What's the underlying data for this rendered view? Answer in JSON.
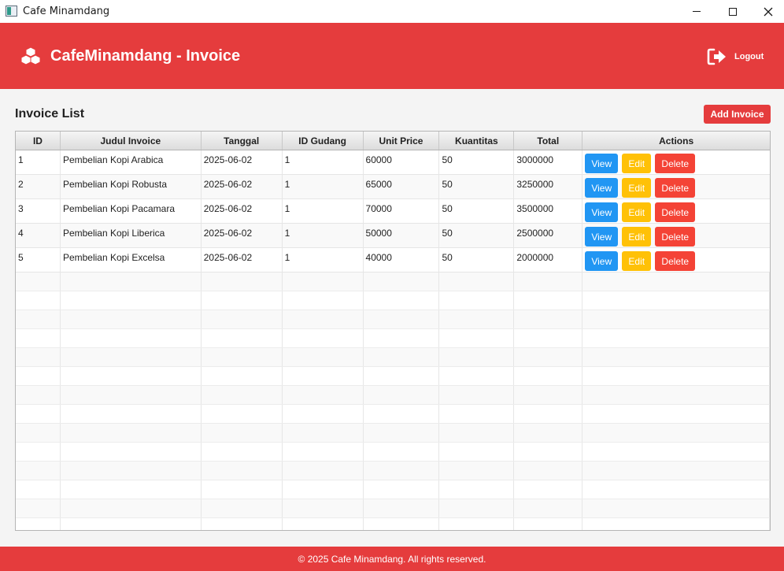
{
  "window": {
    "title": "Cafe Minamdang"
  },
  "header": {
    "brand": "CafeMinamdang - Invoice",
    "logout_label": "Logout"
  },
  "main": {
    "title": "Invoice List",
    "add_button": "Add Invoice",
    "columns": [
      "ID",
      "Judul Invoice",
      "Tanggal",
      "ID Gudang",
      "Unit Price",
      "Kuantitas",
      "Total",
      "Actions"
    ],
    "rows": [
      {
        "id": "1",
        "judul": "Pembelian Kopi Arabica",
        "tanggal": "2025-06-02",
        "gudang": "1",
        "price": "60000",
        "qty": "50",
        "total": "3000000"
      },
      {
        "id": "2",
        "judul": "Pembelian Kopi Robusta",
        "tanggal": "2025-06-02",
        "gudang": "1",
        "price": "65000",
        "qty": "50",
        "total": "3250000"
      },
      {
        "id": "3",
        "judul": "Pembelian Kopi Pacamara",
        "tanggal": "2025-06-02",
        "gudang": "1",
        "price": "70000",
        "qty": "50",
        "total": "3500000"
      },
      {
        "id": "4",
        "judul": "Pembelian Kopi Liberica",
        "tanggal": "2025-06-02",
        "gudang": "1",
        "price": "50000",
        "qty": "50",
        "total": "2500000"
      },
      {
        "id": "5",
        "judul": "Pembelian Kopi Excelsa",
        "tanggal": "2025-06-02",
        "gudang": "1",
        "price": "40000",
        "qty": "50",
        "total": "2000000"
      }
    ],
    "actions": {
      "view": "View",
      "edit": "Edit",
      "delete": "Delete"
    }
  },
  "footer": {
    "text": "© 2025 Cafe Minamdang. All rights reserved."
  },
  "colors": {
    "primary": "#e53c3d",
    "view": "#2196f3",
    "edit": "#ffc107",
    "delete": "#f44336"
  },
  "icons": {
    "brand": "cubes-icon",
    "logout": "logout-icon"
  }
}
